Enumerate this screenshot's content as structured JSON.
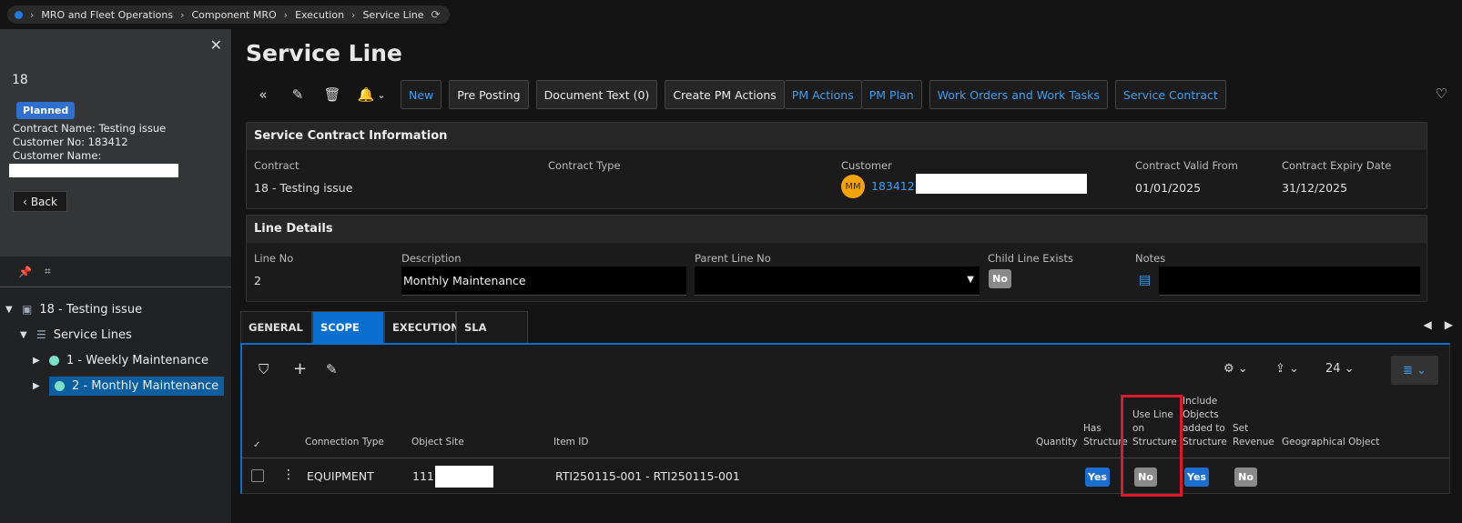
{
  "breadcrumb": [
    "MRO and Fleet Operations",
    "Component MRO",
    "Execution",
    "Service Line"
  ],
  "left": {
    "id": "18",
    "status": "Planned",
    "contract_name": "Contract Name:  Testing issue",
    "customer_no": "Customer No:  183412",
    "customer_name": "Customer Name:",
    "back": "Back",
    "tree": [
      {
        "label": "18 - Testing issue"
      },
      {
        "label": "Service Lines"
      },
      {
        "label": "1 - Weekly Maintenance"
      },
      {
        "label": "2 - Monthly Maintenance"
      }
    ]
  },
  "title": "Service Line",
  "commands": {
    "new": "New",
    "pre_posting": "Pre Posting",
    "document_text": "Document Text (0)",
    "create_pm_actions": "Create PM Actions",
    "pm_actions": "PM Actions",
    "pm_plan": "PM Plan",
    "work_orders": "Work Orders and Work Tasks",
    "service_contract": "Service Contract"
  },
  "contract_info": {
    "heading": "Service Contract Information",
    "contract_label": "Contract",
    "contract_value": "18 - Testing issue",
    "type_label": "Contract Type",
    "customer_label": "Customer",
    "customer_initials": "MM",
    "customer_value": "183412 -",
    "valid_from_label": "Contract Valid From",
    "valid_from": "01/01/2025",
    "expiry_label": "Contract Expiry Date",
    "expiry": "31/12/2025"
  },
  "line_details": {
    "heading": "Line Details",
    "line_no_label": "Line No",
    "line_no": "2",
    "desc_label": "Description",
    "desc": "Monthly Maintenance",
    "parent_label": "Parent Line No",
    "child_label": "Child Line Exists",
    "child_value": "No",
    "notes_label": "Notes"
  },
  "tabs": [
    "GENERAL",
    "SCOPE",
    "EXECUTION",
    "SLA"
  ],
  "grid": {
    "page_size": "24",
    "columns": {
      "connection_type": "Connection Type",
      "object_site": "Object Site",
      "item_id": "Item ID",
      "quantity": "Quantity",
      "has_structure_1": "Has",
      "has_structure_2": "Structure",
      "use_line_1": "Use Line",
      "use_line_2": "on",
      "use_line_3": "Structure",
      "include_1": "Include",
      "include_2": "Objects",
      "include_3": "added to",
      "include_4": "Structure",
      "set_revenue_1": "Set",
      "set_revenue_2": "Revenue",
      "geo": "Geographical Object"
    },
    "row": {
      "connection_type": "EQUIPMENT",
      "object_site": "111",
      "item_id": "RTI250115-001 - RTI250115-001",
      "has_structure": "Yes",
      "use_line": "No",
      "include": "Yes",
      "set_revenue": "No"
    }
  }
}
